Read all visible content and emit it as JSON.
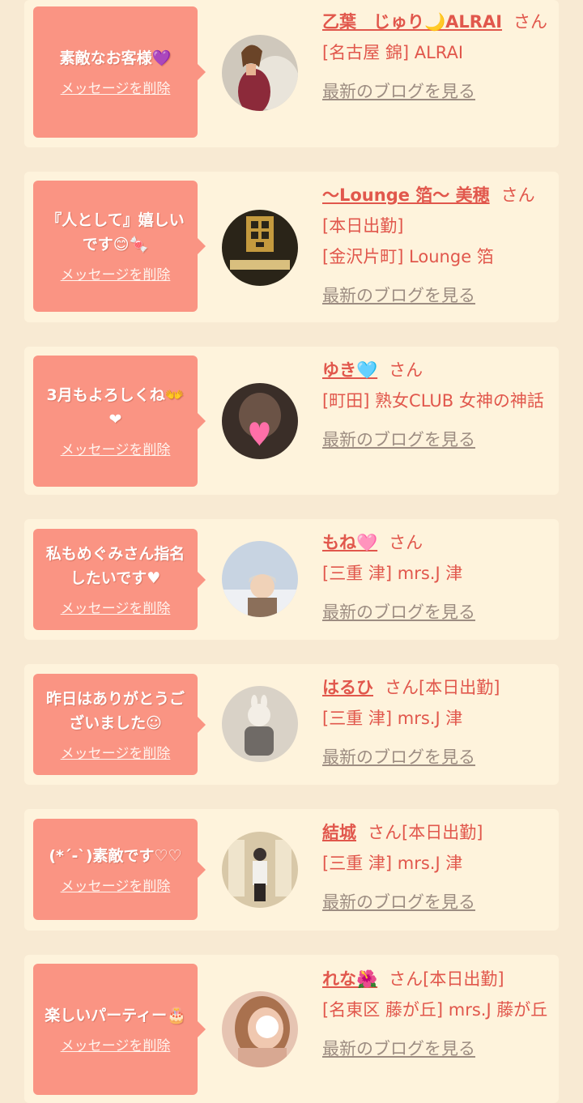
{
  "delete_label": "メッセージを削除",
  "blog_label": "最新のブログを見る",
  "san_label": "さん",
  "items": [
    {
      "message": "素敵なお客様💜",
      "name": "乙葉　じゅり🌙ALRAI",
      "suffix": "",
      "status": "",
      "shop": "[名古屋 錦] ALRAI"
    },
    {
      "message": "『人として』嬉しいです😊🍬",
      "name": "〜Lounge 箔〜 美穂",
      "suffix": "",
      "status": "[本日出勤]",
      "shop": "[金沢片町] Lounge 箔"
    },
    {
      "message": "3月もよろしくね👐❤",
      "name": "ゆき🩵",
      "suffix": "",
      "status": "",
      "shop": "[町田] 熟女CLUB 女神の神話"
    },
    {
      "message": "私もめぐみさん指名したいです♥",
      "name": "もね🩷",
      "suffix": "",
      "status": "",
      "shop": "[三重 津] mrs.J 津"
    },
    {
      "message": "昨日はありがとうございました☺",
      "name": "はるひ",
      "suffix": "[本日出勤]",
      "status": "",
      "shop": "[三重 津] mrs.J 津"
    },
    {
      "message": "(*´-`)素敵です♡♡",
      "name": "結城",
      "suffix": "[本日出勤]",
      "status": "",
      "shop": "[三重 津] mrs.J 津"
    },
    {
      "message": "楽しいパーティー🎂",
      "name": "れな🌺",
      "suffix": "[本日出勤]",
      "status": "",
      "shop": "[名東区 藤が丘] mrs.J 藤が丘"
    }
  ]
}
